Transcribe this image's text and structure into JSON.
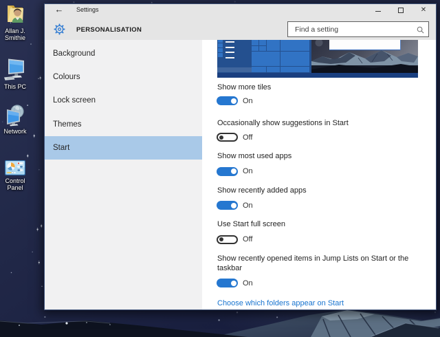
{
  "desktop": {
    "icons": [
      {
        "icon": "user-folder-icon",
        "label_lines": [
          "Allan J.",
          "Smithie"
        ]
      },
      {
        "icon": "this-pc-icon",
        "label_lines": [
          "This PC",
          ""
        ]
      },
      {
        "icon": "network-icon",
        "label_lines": [
          "Network",
          ""
        ]
      },
      {
        "icon": "control-panel-icon",
        "label_lines": [
          "Control",
          "Panel"
        ]
      }
    ]
  },
  "window": {
    "titlebar": {
      "title": "Settings",
      "back_label": "←"
    },
    "header": {
      "page_title": "PERSONALISATION",
      "search_placeholder": "Find a setting"
    },
    "sidebar": {
      "items": [
        {
          "label": "Background",
          "selected": false
        },
        {
          "label": "Colours",
          "selected": false
        },
        {
          "label": "Lock screen",
          "selected": false
        },
        {
          "label": "Themes",
          "selected": false
        },
        {
          "label": "Start",
          "selected": true
        }
      ]
    },
    "content": {
      "preview_name": "start-menu-preview-thumbnail",
      "settings": [
        {
          "label": "Show more tiles",
          "state": "On"
        },
        {
          "label": "Occasionally show suggestions in Start",
          "state": "Off"
        },
        {
          "label": "Show most used apps",
          "state": "On"
        },
        {
          "label": "Show recently added apps",
          "state": "On"
        },
        {
          "label": "Use Start full screen",
          "state": "Off"
        },
        {
          "label": "Show recently opened items in Jump Lists on Start or the taskbar",
          "state": "On"
        }
      ],
      "link": "Choose which folders appear on Start"
    }
  },
  "colors": {
    "accent": "#2577d0",
    "nav_selected": "#a9c9e8",
    "link": "#1874cf",
    "header_bg": "#e5e5e5",
    "sidebar_bg": "#f1f1f2"
  }
}
